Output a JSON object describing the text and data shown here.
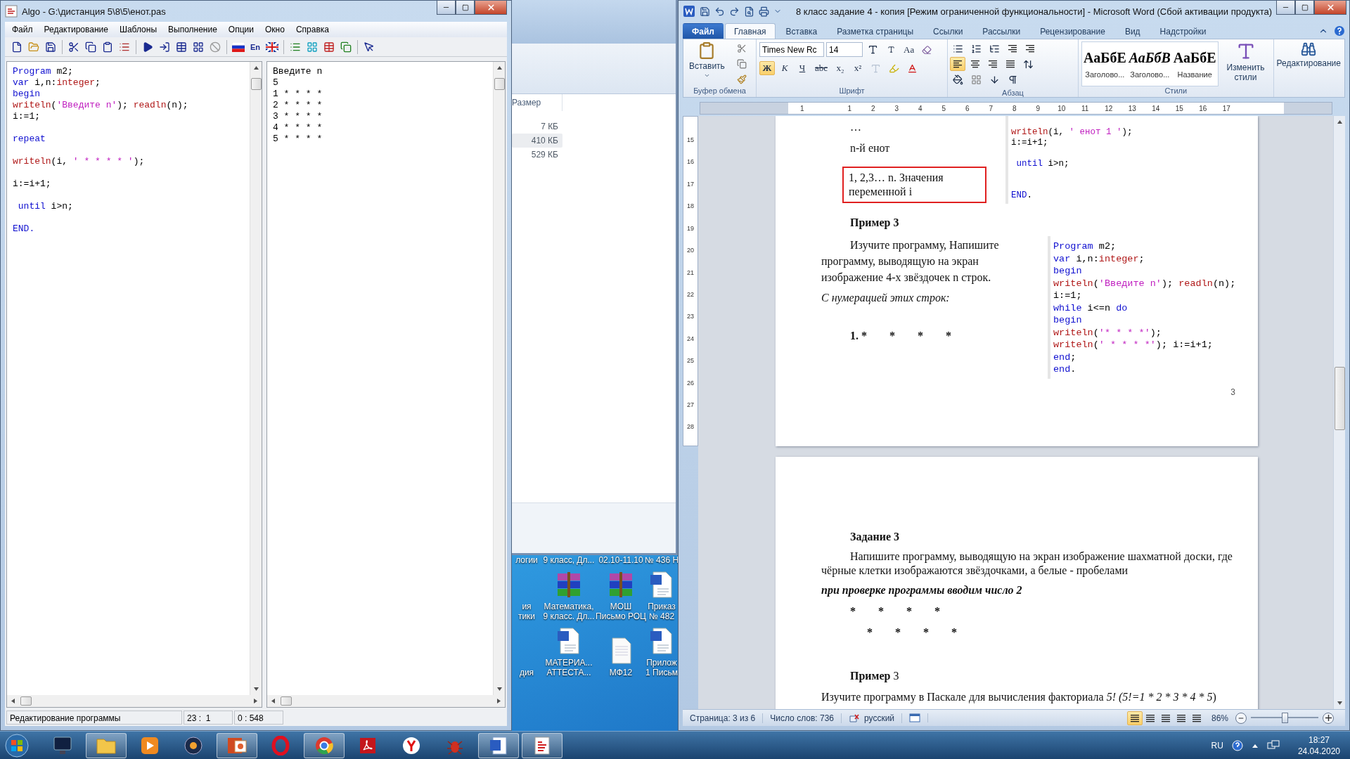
{
  "algo": {
    "title": "Algo - G:\\дистанция 5\\8\\5\\енот.pas",
    "menu": [
      "Файл",
      "Редактирование",
      "Шаблоны",
      "Выполнение",
      "Опции",
      "Окно",
      "Справка"
    ],
    "toolbar_label": "En",
    "editor_lines": [
      {
        "kind": "code",
        "segments": [
          {
            "kind": "keyword",
            "text": "Program"
          },
          {
            "kind": "plain",
            "text": " m2;"
          }
        ]
      },
      {
        "kind": "code",
        "segments": [
          {
            "kind": "keyword",
            "text": "var"
          },
          {
            "kind": "plain",
            "text": " i,n:"
          },
          {
            "kind": "function",
            "text": "integer"
          },
          {
            "kind": "plain",
            "text": ";"
          }
        ]
      },
      {
        "kind": "code",
        "segments": [
          {
            "kind": "keyword",
            "text": "begin"
          }
        ]
      },
      {
        "kind": "code",
        "segments": [
          {
            "kind": "function",
            "text": "writeln"
          },
          {
            "kind": "plain",
            "text": "("
          },
          {
            "kind": "string",
            "text": "'Введите n'"
          },
          {
            "kind": "plain",
            "text": "); "
          },
          {
            "kind": "function",
            "text": "readln"
          },
          {
            "kind": "plain",
            "text": "(n);"
          }
        ]
      },
      {
        "kind": "code",
        "segments": [
          {
            "kind": "plain",
            "text": "i:=1;"
          }
        ]
      },
      {
        "kind": "blank"
      },
      {
        "kind": "code",
        "segments": [
          {
            "kind": "keyword",
            "text": "repeat"
          }
        ]
      },
      {
        "kind": "blank"
      },
      {
        "kind": "code",
        "segments": [
          {
            "kind": "function",
            "text": "writeln"
          },
          {
            "kind": "plain",
            "text": "(i, "
          },
          {
            "kind": "string",
            "text": "' * * * * '"
          },
          {
            "kind": "plain",
            "text": ");"
          }
        ]
      },
      {
        "kind": "blank"
      },
      {
        "kind": "code",
        "segments": [
          {
            "kind": "plain",
            "text": "i:=i+1;"
          }
        ]
      },
      {
        "kind": "blank"
      },
      {
        "kind": "code",
        "segments": [
          {
            "kind": "keyword",
            "text": " until"
          },
          {
            "kind": "plain",
            "text": " i>n;"
          }
        ]
      },
      {
        "kind": "blank"
      },
      {
        "kind": "code",
        "segments": [
          {
            "kind": "keyword",
            "text": "END."
          }
        ]
      }
    ],
    "output_lines": [
      "Введите n",
      "5",
      "1 * * * *",
      "2 * * * *",
      "3 * * * *",
      "4 * * * *",
      "5 * * * *"
    ],
    "status": [
      "Редактирование программы",
      "23 :  1",
      "0 : 548"
    ]
  },
  "explorer": {
    "column_header": "Размер",
    "rows": [
      {
        "size": "7 КБ",
        "selected": false
      },
      {
        "size": "410 КБ",
        "selected": true
      },
      {
        "size": "529 КБ",
        "selected": false
      }
    ]
  },
  "desktop": {
    "rows": [
      [
        {
          "kind": "none",
          "lines": [
            "логии"
          ]
        },
        {
          "kind": "none",
          "lines": [
            "9 класс, Дл..."
          ]
        },
        {
          "kind": "none",
          "lines": [
            "02.10-11.10"
          ]
        },
        {
          "kind": "none",
          "lines": [
            "№ 436 Н"
          ]
        }
      ],
      [
        {
          "kind": "none",
          "lines": [
            "ия",
            "тики"
          ]
        },
        {
          "kind": "archive",
          "lines": [
            "Математика,",
            "9 класс. Дл..."
          ]
        },
        {
          "kind": "archive",
          "lines": [
            "МОШ",
            "Письмо РОЦ"
          ]
        },
        {
          "kind": "word",
          "lines": [
            "Приказ",
            "№ 482"
          ]
        }
      ],
      [
        {
          "kind": "none",
          "lines": [
            "дия"
          ]
        },
        {
          "kind": "word",
          "lines": [
            "МАТЕРИА...",
            "АТТЕСТА..."
          ]
        },
        {
          "kind": "file",
          "lines": [
            "МФ12"
          ]
        },
        {
          "kind": "word",
          "lines": [
            "Прилож",
            "1 Письм"
          ]
        }
      ]
    ]
  },
  "word": {
    "title": "8 класс задание 4 - копия [Режим ограниченной функциональности]  -  Microsoft Word (Сбой активации продукта)",
    "tabs": [
      {
        "label": "Файл",
        "kind": "file",
        "selected": false
      },
      {
        "label": "Главная",
        "kind": "tab",
        "selected": true
      },
      {
        "label": "Вставка",
        "kind": "tab",
        "selected": false
      },
      {
        "label": "Разметка страницы",
        "kind": "tab",
        "selected": false
      },
      {
        "label": "Ссылки",
        "kind": "tab",
        "selected": false
      },
      {
        "label": "Рассылки",
        "kind": "tab",
        "selected": false
      },
      {
        "label": "Рецензирование",
        "kind": "tab",
        "selected": false
      },
      {
        "label": "Вид",
        "kind": "tab",
        "selected": false
      },
      {
        "label": "Надстройки",
        "kind": "tab",
        "selected": false
      }
    ],
    "ribbon": {
      "clipboard": {
        "paste": "Вставить",
        "group": "Буфер обмена"
      },
      "font": {
        "name": "Times New Rc",
        "size": "14",
        "case_label": "Aa",
        "group": "Шрифт",
        "buttons": [
          {
            "label": "Ж",
            "kind": "bold",
            "selected": true
          },
          {
            "label": "К",
            "kind": "italic",
            "selected": false
          },
          {
            "label": "Ч",
            "kind": "underline",
            "selected": false
          },
          {
            "label": "abc",
            "kind": "strike",
            "selected": false
          },
          {
            "label": "x₂",
            "kind": "plain",
            "selected": false
          },
          {
            "label": "x²",
            "kind": "plain",
            "selected": false
          }
        ]
      },
      "paragraph": {
        "group": "Абзац",
        "alignments": [
          {
            "selected": true
          },
          {
            "selected": false
          },
          {
            "selected": false
          },
          {
            "selected": false
          }
        ]
      },
      "styles": {
        "group": "Стили",
        "change": "Изменить стили",
        "items": [
          {
            "sample": "АаБбЕ",
            "label": "Заголово...",
            "italic": false
          },
          {
            "sample": "АаБбВ",
            "label": "Заголово...",
            "italic": true
          },
          {
            "sample": "АаБбЕ",
            "label": "Название",
            "italic": false
          }
        ]
      },
      "editing": "Редактирование"
    },
    "ruler": [
      "1",
      "1",
      "2",
      "3",
      "4",
      "5",
      "6",
      "7",
      "8",
      "9",
      "10",
      "11",
      "12",
      "13",
      "14",
      "15",
      "16",
      "17"
    ],
    "vruler": [
      "15",
      "16",
      "17",
      "18",
      "19",
      "20",
      "21",
      "22",
      "23",
      "24",
      "25",
      "26",
      "27",
      "28"
    ],
    "page1": {
      "left": [
        {
          "kind": "plain",
          "text": "…"
        },
        {
          "kind": "plain",
          "text": "n-й енот"
        },
        {
          "kind": "boxed",
          "text": "1, 2,3… n. Значения переменной i"
        },
        {
          "kind": "heading",
          "text": "Пример 3"
        },
        {
          "kind": "indent",
          "text": "Изучите программу, Напишите программу, выводящую на экран изображение 4-х звёздочек n строк."
        },
        {
          "kind": "italic",
          "text": "С нумерацией этих строк:"
        },
        {
          "kind": "stars",
          "text": "1. *        *        *        *"
        }
      ],
      "snippets": [
        [
          {
            "kind": "code",
            "segments": [
              {
                "kind": "function",
                "text": "writeln"
              },
              {
                "kind": "plain",
                "text": "(i, "
              },
              {
                "kind": "string",
                "text": "' енот 1 '"
              },
              {
                "kind": "plain",
                "text": ");"
              }
            ]
          },
          {
            "kind": "code",
            "segments": [
              {
                "kind": "plain",
                "text": "i:=i+1;"
              }
            ]
          },
          {
            "kind": "blank"
          },
          {
            "kind": "code",
            "segments": [
              {
                "kind": "keyword",
                "text": " until"
              },
              {
                "kind": "plain",
                "text": " i>n;"
              }
            ]
          },
          {
            "kind": "blank"
          },
          {
            "kind": "blank"
          },
          {
            "kind": "code",
            "segments": [
              {
                "kind": "keyword",
                "text": "END"
              },
              {
                "kind": "plain",
                "text": "."
              }
            ]
          }
        ],
        [
          {
            "kind": "code",
            "segments": [
              {
                "kind": "keyword",
                "text": "Program"
              },
              {
                "kind": "plain",
                "text": " m2;"
              }
            ]
          },
          {
            "kind": "code",
            "segments": [
              {
                "kind": "keyword",
                "text": "var"
              },
              {
                "kind": "plain",
                "text": " i,n:"
              },
              {
                "kind": "function",
                "text": "integer"
              },
              {
                "kind": "plain",
                "text": ";"
              }
            ]
          },
          {
            "kind": "code",
            "segments": [
              {
                "kind": "keyword",
                "text": "begin"
              }
            ]
          },
          {
            "kind": "code",
            "segments": [
              {
                "kind": "function",
                "text": "writeln"
              },
              {
                "kind": "plain",
                "text": "("
              },
              {
                "kind": "string",
                "text": "'Введите n'"
              },
              {
                "kind": "plain",
                "text": "); "
              },
              {
                "kind": "function",
                "text": "readln"
              },
              {
                "kind": "plain",
                "text": "(n);"
              }
            ]
          },
          {
            "kind": "code",
            "segments": [
              {
                "kind": "plain",
                "text": "i:=1;"
              }
            ]
          },
          {
            "kind": "code",
            "segments": [
              {
                "kind": "keyword",
                "text": "while"
              },
              {
                "kind": "plain",
                "text": " i<=n "
              },
              {
                "kind": "keyword",
                "text": "do"
              }
            ]
          },
          {
            "kind": "code",
            "segments": [
              {
                "kind": "keyword",
                "text": "begin"
              }
            ]
          },
          {
            "kind": "code",
            "segments": [
              {
                "kind": "function",
                "text": "writeln"
              },
              {
                "kind": "plain",
                "text": "("
              },
              {
                "kind": "string",
                "text": "'* * * *'"
              },
              {
                "kind": "plain",
                "text": ");"
              }
            ]
          },
          {
            "kind": "code",
            "segments": [
              {
                "kind": "function",
                "text": "writeln"
              },
              {
                "kind": "plain",
                "text": "("
              },
              {
                "kind": "string",
                "text": "' * * * *'"
              },
              {
                "kind": "plain",
                "text": "); i:=i+1;"
              }
            ]
          },
          {
            "kind": "code",
            "segments": [
              {
                "kind": "keyword",
                "text": "end"
              },
              {
                "kind": "plain",
                "text": ";"
              }
            ]
          },
          {
            "kind": "code",
            "segments": [
              {
                "kind": "keyword",
                "text": "end"
              },
              {
                "kind": "plain",
                "text": "."
              }
            ]
          }
        ]
      ],
      "page_number": "3"
    },
    "page2": [
      {
        "kind": "heading",
        "text": "Задание 3"
      },
      {
        "kind": "indent",
        "text": "Напишите программу, выводящую на экран изображение  шахматной доски, где чёрные клетки изображаются звёздочками, а белые  - пробелами"
      },
      {
        "kind": "bold-italic",
        "text": "при проверке программы вводим число 2"
      },
      {
        "kind": "stars",
        "text": "*        *        *        *"
      },
      {
        "kind": "stars-shifted",
        "text": "*        *        *        *"
      },
      {
        "kind": "heading-rich",
        "text": "**Пример** 3"
      },
      {
        "kind": "parts",
        "parts": [
          {
            "text": "Изучите программу в Паскале для вычисления факториала ",
            "italic": false
          },
          {
            "text": "5! (5!=1 * 2 * 3 * 4 * 5",
            "italic": true
          },
          {
            "text": ")",
            "italic": false
          }
        ]
      }
    ],
    "status": {
      "page": "Страница: 3 из 6",
      "words": "Число слов: 736",
      "language": "русский",
      "zoom": "86%",
      "zoom_slider": {
        "level": 0.5
      }
    }
  },
  "taskbar": {
    "apps": [
      {
        "kind": "monitor",
        "running": false
      },
      {
        "kind": "folder",
        "running": true
      },
      {
        "kind": "play",
        "running": false
      },
      {
        "kind": "disc",
        "running": false
      },
      {
        "kind": "slides",
        "running": true
      },
      {
        "kind": "ring",
        "running": false
      },
      {
        "kind": "wheel",
        "running": true
      },
      {
        "kind": "pdf",
        "running": false
      },
      {
        "kind": "ycircle",
        "running": false
      },
      {
        "kind": "bug",
        "running": false
      },
      {
        "kind": "word",
        "running": true
      },
      {
        "kind": "algo",
        "running": true
      }
    ],
    "lang": "RU",
    "time": "18:27",
    "date": "24.04.2020"
  }
}
